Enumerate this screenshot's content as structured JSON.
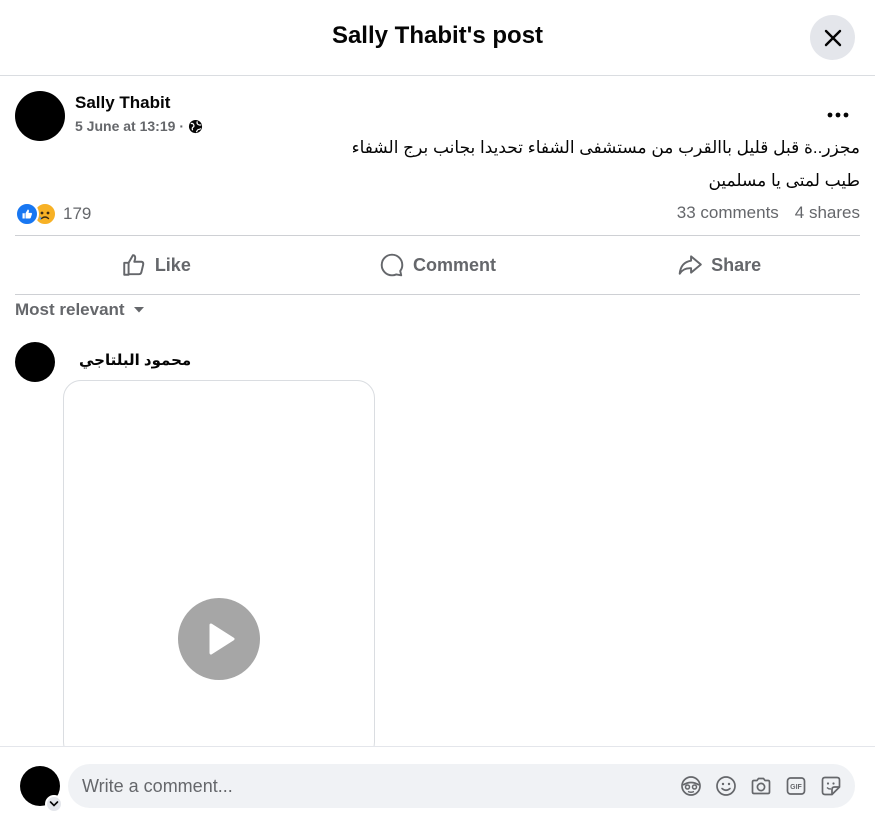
{
  "dialog": {
    "title": "Sally Thabit's post",
    "close_icon": "close-icon"
  },
  "post": {
    "author": "Sally Thabit",
    "timestamp": "5 June at 13:19",
    "separator": "·",
    "audience_icon": "globe-icon",
    "text_line1": "مجزر..ة قبل قليل باالقرب من مستشفى الشفاء تحديدا بجانب برج الشفاء",
    "text_line2": "طيب لمتى يا مسلمين"
  },
  "stats": {
    "reaction_icons": [
      "like-reaction-icon",
      "sad-reaction-icon"
    ],
    "reactions_count": "179",
    "comments": "33 comments",
    "shares": "4 shares"
  },
  "actions": {
    "like": "Like",
    "comment": "Comment",
    "share": "Share"
  },
  "sort": {
    "label": "Most relevant"
  },
  "comment": {
    "author": "محمود البلتاجي"
  },
  "composer": {
    "placeholder": "Write a comment...",
    "tools": [
      "avatar-sticker-icon",
      "emoji-icon",
      "camera-icon",
      "gif-icon",
      "sticker-icon"
    ]
  },
  "colors": {
    "like_blue": "#1877f2",
    "secondary_text": "#65676b",
    "sad_yellow": "#f7b125"
  }
}
